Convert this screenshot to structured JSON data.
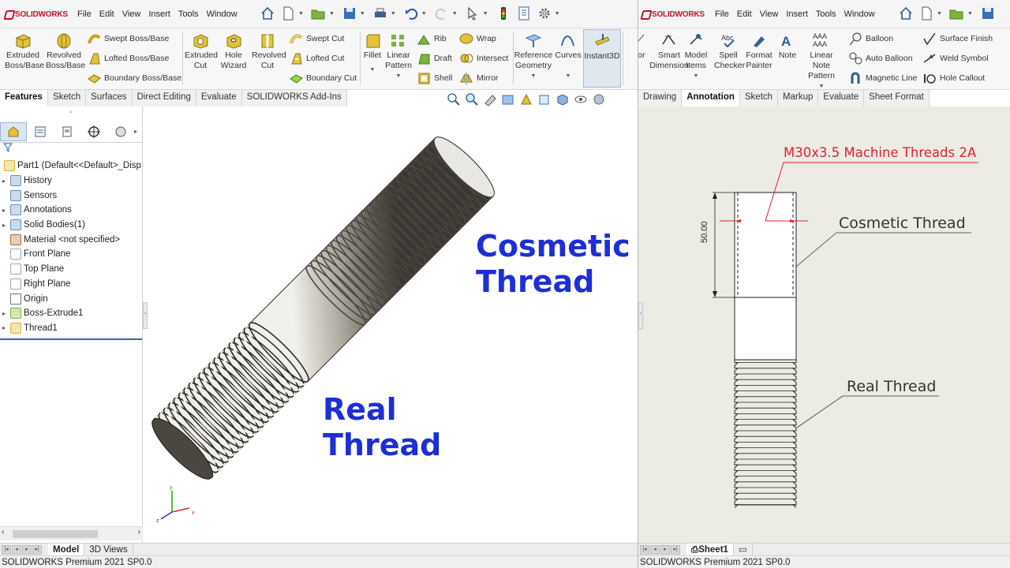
{
  "left_window": {
    "brand": "SOLIDWORKS",
    "menu": [
      "File",
      "Edit",
      "View",
      "Insert",
      "Tools",
      "Window"
    ],
    "ribbon": {
      "extruded_boss": "Extruded Boss/Base",
      "revolved_boss": "Revolved Boss/Base",
      "swept_boss": "Swept Boss/Base",
      "lofted_boss": "Lofted Boss/Base",
      "boundary_boss": "Boundary Boss/Base",
      "extruded_cut": "Extruded Cut",
      "hole_wizard": "Hole Wizard",
      "revolved_cut": "Revolved Cut",
      "swept_cut": "Swept Cut",
      "lofted_cut": "Lofted Cut",
      "boundary_cut": "Boundary Cut",
      "fillet": "Fillet",
      "linear_pattern": "Linear Pattern",
      "rib": "Rib",
      "draft": "Draft",
      "shell": "Shell",
      "wrap": "Wrap",
      "intersect": "Intersect",
      "mirror": "Mirror",
      "reference_geometry": "Reference Geometry",
      "curves": "Curves",
      "instant3d": "Instant3D"
    },
    "tabs": [
      "Features",
      "Sketch",
      "Surfaces",
      "Direct Editing",
      "Evaluate",
      "SOLIDWORKS Add-Ins"
    ],
    "active_tab": "Features",
    "tree": [
      {
        "label": "Part1  (Default<<Default>_Disp",
        "expand": "",
        "icon": "part-icon"
      },
      {
        "label": "History",
        "expand": "▸",
        "icon": "history-icon"
      },
      {
        "label": "Sensors",
        "expand": "",
        "icon": "sensors-icon"
      },
      {
        "label": "Annotations",
        "expand": "▸",
        "icon": "annotations-icon"
      },
      {
        "label": "Solid Bodies(1)",
        "expand": "▸",
        "icon": "solid-bodies-icon"
      },
      {
        "label": "Material <not specified>",
        "expand": "",
        "icon": "material-icon"
      },
      {
        "label": "Front Plane",
        "expand": "",
        "icon": "plane-icon"
      },
      {
        "label": "Top Plane",
        "expand": "",
        "icon": "plane-icon"
      },
      {
        "label": "Right Plane",
        "expand": "",
        "icon": "plane-icon"
      },
      {
        "label": "Origin",
        "expand": "",
        "icon": "origin-icon"
      },
      {
        "label": "Boss-Extrude1",
        "expand": "▸",
        "icon": "boss-extrude-icon"
      },
      {
        "label": "Thread1",
        "expand": "▸",
        "icon": "thread-icon"
      }
    ],
    "overlay_text": {
      "cosmetic_line1": "Cosmetic",
      "cosmetic_line2": "Thread",
      "real_line1": "Real",
      "real_line2": "Thread"
    },
    "bottom_tabs": [
      "Model",
      "3D Views"
    ],
    "active_bottom_tab": "Model",
    "status": "SOLIDWORKS Premium 2021 SP0.0"
  },
  "right_window": {
    "brand": "SOLIDWORKS",
    "menu": [
      "File",
      "Edit",
      "View",
      "Insert",
      "Tools",
      "Window"
    ],
    "ribbon": {
      "partial_left": "Nor",
      "smart_dimension": "Smart Dimension",
      "model_items": "Model Items",
      "spell_checker": "Spell Checker",
      "format_painter": "Format Painter",
      "note": "Note",
      "linear_note_pattern": "Linear Note Pattern",
      "balloon": "Balloon",
      "auto_balloon": "Auto Balloon",
      "magnetic_line": "Magnetic Line",
      "surface_finish": "Surface Finish",
      "weld_symbol": "Weld Symbol",
      "hole_callout": "Hole Callout"
    },
    "tabs": [
      "Drawing",
      "Annotation",
      "Sketch",
      "Markup",
      "Evaluate",
      "Sheet Format"
    ],
    "active_tab": "Annotation",
    "drawing": {
      "callout": "M30x3.5 Machine Threads 2A",
      "cosmetic_label": "Cosmetic Thread",
      "real_label": "Real Thread",
      "dimension": "50.00"
    },
    "sheet_tab": "Sheet1",
    "status": "SOLIDWORKS Premium 2021 SP0.0"
  },
  "colors": {
    "label_blue": "#1d2fd4",
    "callout_red": "#e0202a",
    "brand_red": "#c8102e"
  }
}
